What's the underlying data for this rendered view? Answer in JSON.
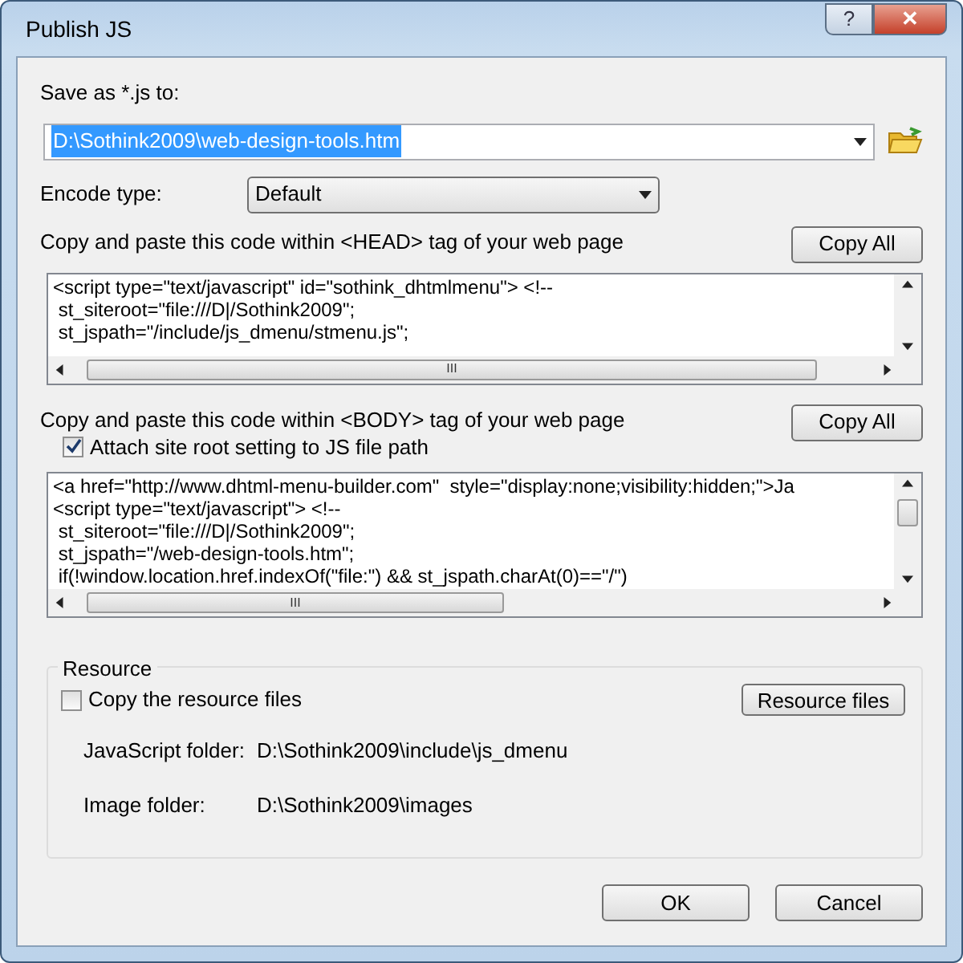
{
  "window": {
    "title": "Publish JS",
    "buttons": [
      "?",
      "✕"
    ]
  },
  "save_as": {
    "label": "Save as *.js to:",
    "value": "D:\\Sothink2009\\web-design-tools.htm",
    "selected": true
  },
  "encode": {
    "label": "Encode type:",
    "value": "Default"
  },
  "head_code": {
    "label": "Copy and paste this code within <HEAD> tag of your web page",
    "button": "Copy All",
    "lines": [
      "<script type=\"text/javascript\" id=\"sothink_dhtmlmenu\"> <!--",
      " st_siteroot=\"file:///D|/Sothink2009\";",
      " st_jspath=\"/include/js_dmenu/stmenu.js\";"
    ],
    "scroll_grip": "III"
  },
  "body_code": {
    "label": "Copy and paste this code within <BODY> tag of your web page",
    "button": "Copy All",
    "attach": {
      "label": "Attach site root setting to JS file path",
      "checked": true
    },
    "lines": [
      "<a href=\"http://www.dhtml-menu-builder.com\"  style=\"display:none;visibility:hidden;\">Ja",
      "<script type=\"text/javascript\"> <!--",
      " st_siteroot=\"file:///D|/Sothink2009\";",
      " st_jspath=\"/web-design-tools.htm\";",
      " if(!window.location.href.indexOf(\"file:\") && st_jspath.charAt(0)==\"/\")"
    ],
    "scroll_grip": "III"
  },
  "resource": {
    "title": "Resource",
    "copy": {
      "label": "Copy the resource files",
      "checked": false
    },
    "button": "Resource files",
    "folders": [
      {
        "label": "JavaScript folder:",
        "value": "D:\\Sothink2009\\include\\js_dmenu"
      },
      {
        "label": "Image folder:",
        "value": "D:\\Sothink2009\\images"
      }
    ]
  },
  "buttons": [
    "OK",
    "Cancel"
  ]
}
